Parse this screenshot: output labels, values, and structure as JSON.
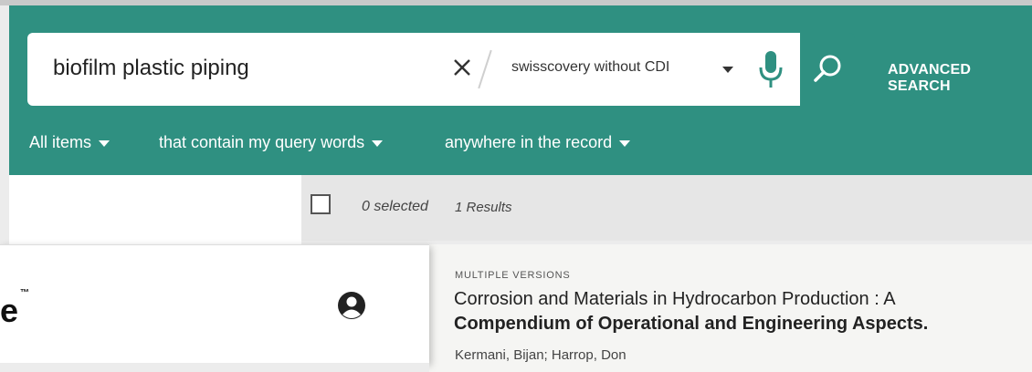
{
  "search": {
    "query": "biofilm plastic piping",
    "scope": "swisscovery without CDI",
    "advanced_label": "ADVANCED SEARCH"
  },
  "filters": {
    "items": "All items",
    "match": "that contain my query words",
    "where": "anywhere in the record"
  },
  "results_bar": {
    "selected": "0 selected",
    "count": "1 Results"
  },
  "result": {
    "badge": "MULTIPLE VERSIONS",
    "title_line1": "Corrosion and Materials in Hydrocarbon Production : A",
    "title_line2": "Compendium of Operational and Engineering Aspects.",
    "authors": "Kermani, Bijan; Harrop, Don"
  },
  "overlay": {
    "logo_fragment": "e",
    "trademark": "™",
    "user_icon": "user-circle-icon"
  },
  "colors": {
    "brand_teal": "#2f9081",
    "header_text": "#ffffff",
    "mic_green": "#2f9081"
  }
}
